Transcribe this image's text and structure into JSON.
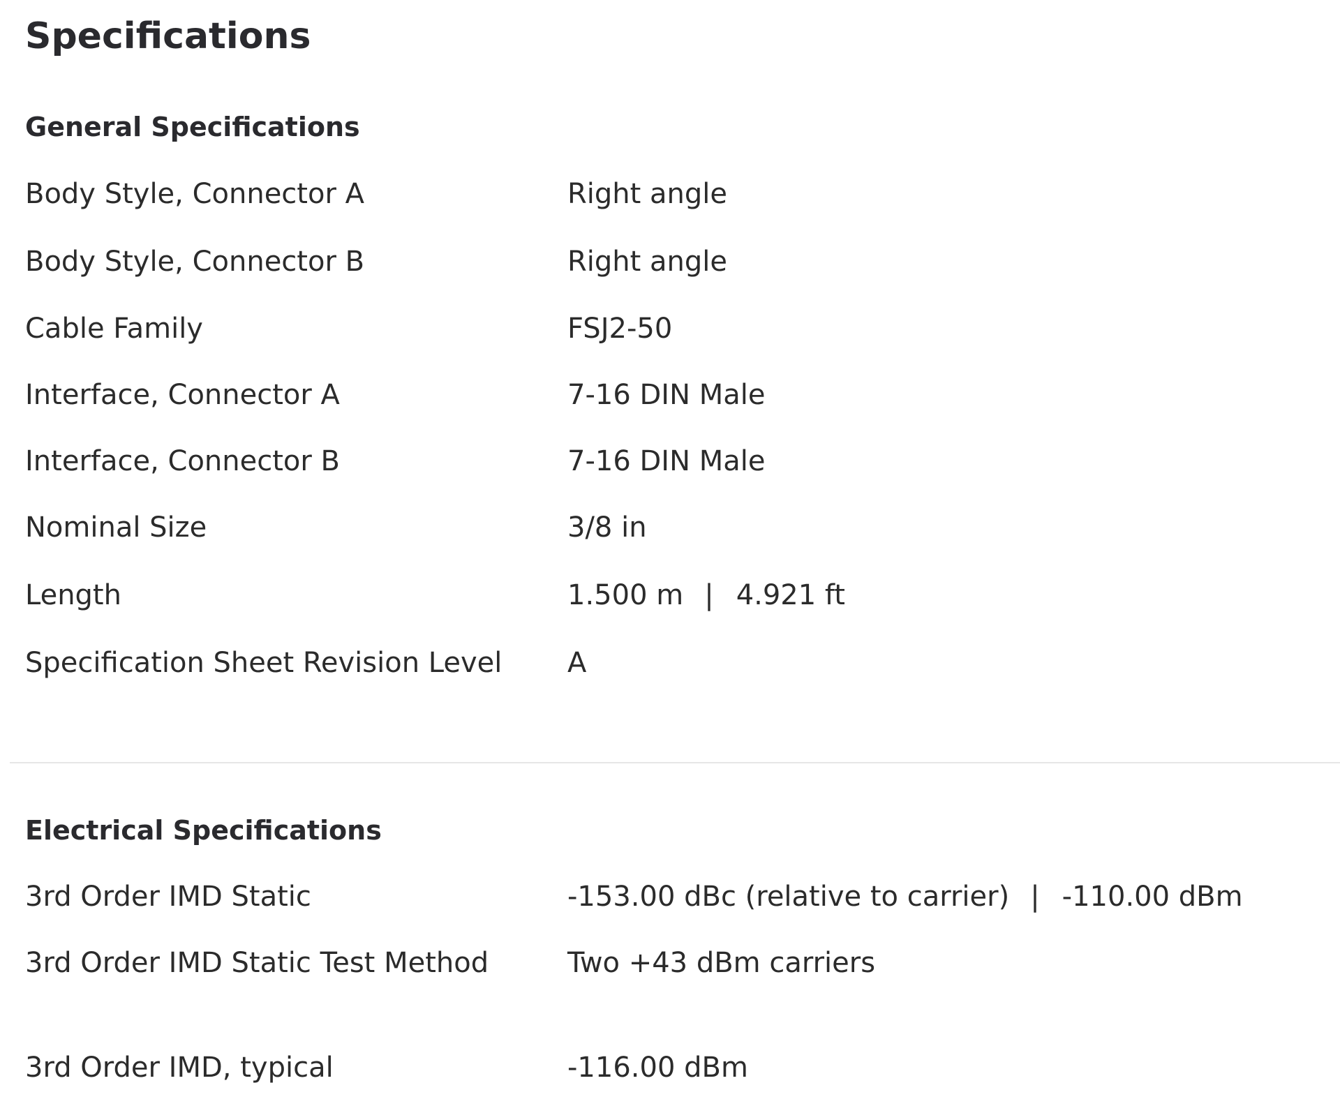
{
  "page": {
    "title": "Specifications"
  },
  "general": {
    "title": "General Specifications",
    "rows": [
      {
        "label": "Body Style, Connector A",
        "value": "Right angle"
      },
      {
        "label": "Body Style, Connector B",
        "value": "Right angle"
      },
      {
        "label": "Cable Family",
        "value": "FSJ2-50"
      },
      {
        "label": "Interface, Connector A",
        "value": "7-16 DIN Male"
      },
      {
        "label": "Interface, Connector B",
        "value": "7-16 DIN Male"
      },
      {
        "label": "Nominal Size",
        "value": "3/8 in"
      },
      {
        "label": "Length",
        "value": "1.500 m",
        "separator": "|",
        "value_alt": "4.921 ft"
      },
      {
        "label": "Specification Sheet Revision Level",
        "value": "A"
      }
    ]
  },
  "electrical": {
    "title": "Electrical Specifications",
    "rows": [
      {
        "label": "3rd Order IMD Static",
        "value": "-153.00 dBc (relative to carrier)",
        "separator": "|",
        "value_alt": "-110.00 dBm"
      },
      {
        "label": "3rd Order IMD Static Test Method",
        "value": "Two +43 dBm carriers"
      },
      {
        "label": "3rd Order IMD, typical",
        "value": "-116.00 dBm"
      }
    ]
  }
}
